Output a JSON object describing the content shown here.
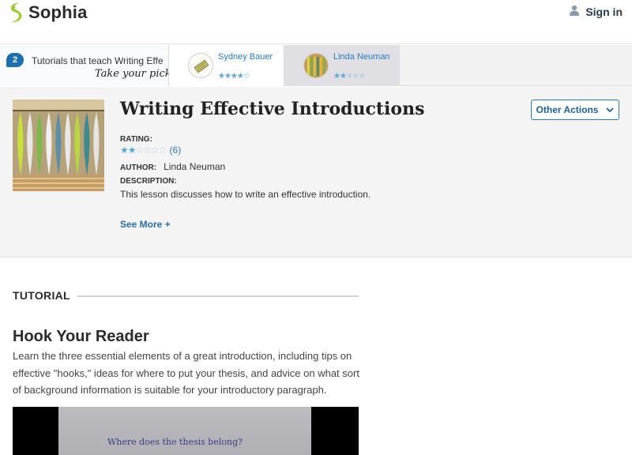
{
  "header": {
    "brand": "Sophia",
    "signin_label": "Sign in"
  },
  "picker": {
    "count": "2",
    "title": "Tutorials that teach Writing Effective Introductions",
    "subtitle": "Take your pick:",
    "tutorials": [
      {
        "author": "Sydney Bauer",
        "stars": "★★★★☆",
        "rating": 4
      },
      {
        "author": "Linda Neuman",
        "stars": "★★☆☆☆",
        "rating": 2
      }
    ]
  },
  "lesson": {
    "title": "Writing Effective Introductions",
    "other_actions_label": "Other Actions",
    "rating_label": "RATING:",
    "rating_stars_filled": "★★",
    "rating_stars_empty": "☆☆☆☆",
    "rating_count": "(6)",
    "author_label": "AUTHOR:",
    "author": "Linda Neuman",
    "description_label": "DESCRIPTION:",
    "description": "This lesson discusses how to write an effective introduction.",
    "see_more": "See More +"
  },
  "tutorial": {
    "heading": "TUTORIAL",
    "section_title": "Hook Your Reader",
    "section_desc": "Learn the three essential elements of a great introduction, including tips on effective \"hooks,\" ideas for where to put your thesis, and advice on what sort of background information is suitable for your introductory paragraph.",
    "video_caption": "Where does the thesis belong?"
  },
  "colors": {
    "brand_green": "#9acd32",
    "link_blue": "#2a7ab8",
    "badge_blue": "#1c6fb0",
    "star_blue": "#5aa6d6"
  },
  "icons": [
    "sophia-logo-icon",
    "user-icon",
    "chevron-down-icon",
    "star-icon"
  ]
}
